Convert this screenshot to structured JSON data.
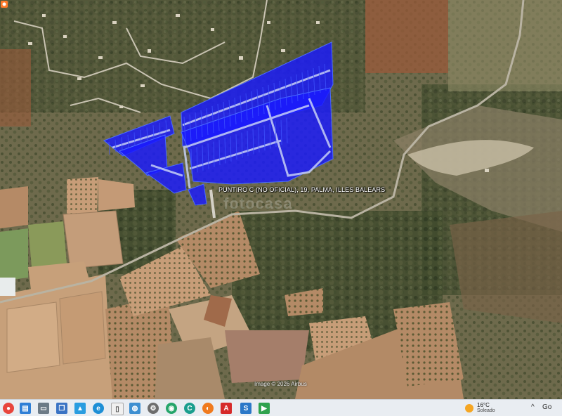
{
  "map": {
    "place_label": "PUNTIRO C (NO OFICIAL), 19, PALMA, ILLES BALEARS",
    "watermark": "fotocasa",
    "credit": "Image © 2026 Airbus",
    "overlay_color": "#1a1aff",
    "overlay_stroke": "#4a6cff",
    "marker_color": "#ff7a2a"
  },
  "taskbar": {
    "temperature": "16°C",
    "condition": "Soleado",
    "icons": [
      "chrome-icon",
      "docs-icon",
      "printer-icon",
      "window-switch-icon",
      "photos-icon",
      "edge-icon",
      "file-icon",
      "file-explorer-icon",
      "settings-icon",
      "whatsapp-icon",
      "firefox-icon",
      "acrobat-icon",
      "slides-icon",
      "sheets-icon"
    ],
    "tray_label": "Go"
  }
}
